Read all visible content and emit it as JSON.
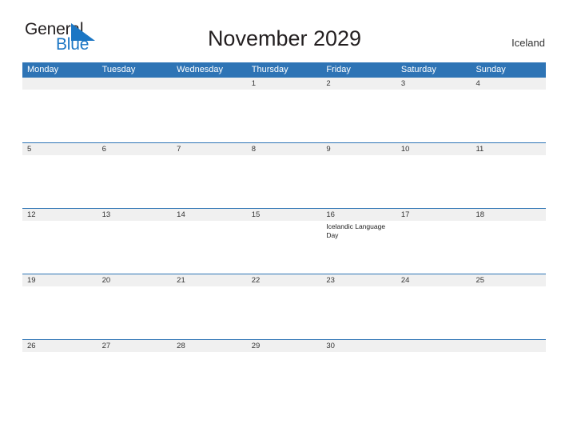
{
  "brand": {
    "name_part1": "General",
    "name_part2": "Blue",
    "triangle_color": "#1b76c4",
    "text_color": "#231f20"
  },
  "header": {
    "title": "November 2029",
    "region": "Iceland"
  },
  "theme": {
    "header_blue": "#2e74b5",
    "band_gray": "#f0f0f0",
    "text_dark": "#231f20",
    "accent_blue": "#1b76c4"
  },
  "calendar": {
    "weekdays": [
      {
        "label": "Monday"
      },
      {
        "label": "Tuesday"
      },
      {
        "label": "Wednesday"
      },
      {
        "label": "Thursday"
      },
      {
        "label": "Friday"
      },
      {
        "label": "Saturday"
      },
      {
        "label": "Sunday"
      }
    ],
    "weeks": [
      {
        "days": [
          {
            "date": "",
            "event": ""
          },
          {
            "date": "",
            "event": ""
          },
          {
            "date": "",
            "event": ""
          },
          {
            "date": "1",
            "event": ""
          },
          {
            "date": "2",
            "event": ""
          },
          {
            "date": "3",
            "event": ""
          },
          {
            "date": "4",
            "event": ""
          }
        ]
      },
      {
        "days": [
          {
            "date": "5",
            "event": ""
          },
          {
            "date": "6",
            "event": ""
          },
          {
            "date": "7",
            "event": ""
          },
          {
            "date": "8",
            "event": ""
          },
          {
            "date": "9",
            "event": ""
          },
          {
            "date": "10",
            "event": ""
          },
          {
            "date": "11",
            "event": ""
          }
        ]
      },
      {
        "days": [
          {
            "date": "12",
            "event": ""
          },
          {
            "date": "13",
            "event": ""
          },
          {
            "date": "14",
            "event": ""
          },
          {
            "date": "15",
            "event": ""
          },
          {
            "date": "16",
            "event": "Icelandic Language Day"
          },
          {
            "date": "17",
            "event": ""
          },
          {
            "date": "18",
            "event": ""
          }
        ]
      },
      {
        "days": [
          {
            "date": "19",
            "event": ""
          },
          {
            "date": "20",
            "event": ""
          },
          {
            "date": "21",
            "event": ""
          },
          {
            "date": "22",
            "event": ""
          },
          {
            "date": "23",
            "event": ""
          },
          {
            "date": "24",
            "event": ""
          },
          {
            "date": "25",
            "event": ""
          }
        ]
      },
      {
        "days": [
          {
            "date": "26",
            "event": ""
          },
          {
            "date": "27",
            "event": ""
          },
          {
            "date": "28",
            "event": ""
          },
          {
            "date": "29",
            "event": ""
          },
          {
            "date": "30",
            "event": ""
          },
          {
            "date": "",
            "event": ""
          },
          {
            "date": "",
            "event": ""
          }
        ]
      }
    ]
  }
}
